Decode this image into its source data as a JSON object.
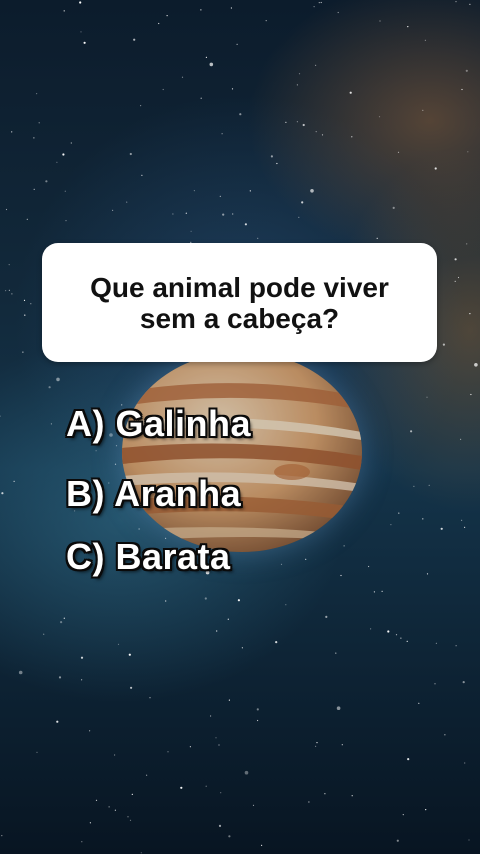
{
  "question": {
    "text": "Que animal pode viver sem a cabeça?"
  },
  "options": [
    {
      "label": "A) Galinha"
    },
    {
      "label": "B) Aranha"
    },
    {
      "label": "C) Barata"
    }
  ],
  "colors": {
    "card_background": "#ffffff",
    "question_text": "#111111",
    "option_text": "#ffffff",
    "option_outline": "#0a0a0a",
    "space_background": "#12293b"
  },
  "decorations": {
    "background_image": "space-starfield",
    "planet": "jupiter-like-planet"
  }
}
